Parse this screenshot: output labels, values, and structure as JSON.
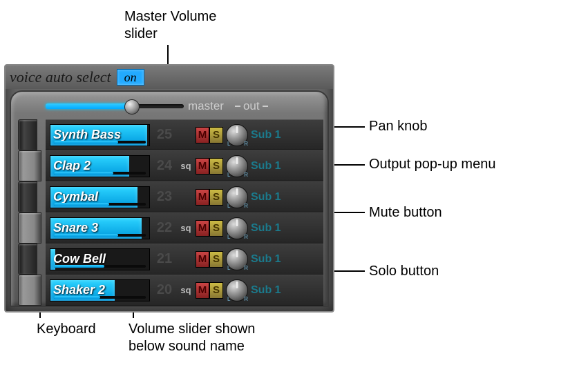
{
  "annotations": {
    "master_volume": "Master Volume\nslider",
    "pan_knob": "Pan knob",
    "output_popup": "Output pop-up menu",
    "mute_button": "Mute button",
    "solo_button": "Solo button",
    "keyboard": "Keyboard",
    "volume_slider": "Volume slider shown\nbelow sound name"
  },
  "voice_auto_select": {
    "label": "voice auto select",
    "state": "on"
  },
  "master": {
    "label": "master",
    "out_label": "out",
    "value_pct": 62
  },
  "tracks": [
    {
      "name": "Synth Bass",
      "num": "25",
      "sq": "",
      "fill_pct": 98,
      "vol_pct": 70,
      "output": "Sub 1"
    },
    {
      "name": "Clap 2",
      "num": "24",
      "sq": "sq",
      "fill_pct": 80,
      "vol_pct": 65,
      "output": "Sub 1"
    },
    {
      "name": "Cymbal",
      "num": "23",
      "sq": "",
      "fill_pct": 88,
      "vol_pct": 60,
      "output": "Sub 1"
    },
    {
      "name": "Snare 3",
      "num": "22",
      "sq": "sq",
      "fill_pct": 92,
      "vol_pct": 70,
      "output": "Sub 1"
    },
    {
      "name": "Cow Bell",
      "num": "21",
      "sq": "",
      "fill_pct": 5,
      "vol_pct": 55,
      "output": "Sub 1"
    },
    {
      "name": "Shaker 2",
      "num": "20",
      "sq": "sq",
      "fill_pct": 65,
      "vol_pct": 50,
      "output": "Sub 1"
    }
  ],
  "btn_labels": {
    "mute": "M",
    "solo": "S"
  }
}
